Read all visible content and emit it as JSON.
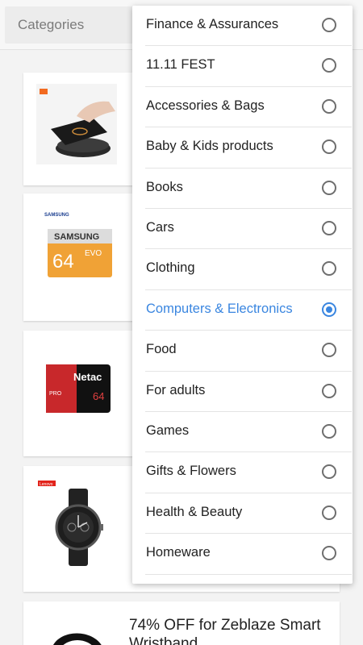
{
  "header": {
    "categories_label": "Categories"
  },
  "products": [
    {
      "title": ""
    },
    {
      "title": ""
    },
    {
      "title": ""
    },
    {
      "title": ""
    },
    {
      "title": "74% OFF for Zeblaze Smart Wristband"
    }
  ],
  "thumb_text": {
    "samsung_brand": "SAMSUNG",
    "samsung_card": "SAMSUNG",
    "samsung_cap": "64",
    "samsung_evo": "EVO",
    "netac_brand": "Netac",
    "netac_pro": "PRO",
    "netac_cap": "64",
    "lenovo_brand": "Lenovo"
  },
  "dropdown": {
    "options": [
      {
        "label": "Finance & Assurances",
        "selected": false
      },
      {
        "label": "11.11 FEST",
        "selected": false
      },
      {
        "label": "Accessories & Bags",
        "selected": false
      },
      {
        "label": "Baby & Kids products",
        "selected": false
      },
      {
        "label": "Books",
        "selected": false
      },
      {
        "label": "Cars",
        "selected": false
      },
      {
        "label": "Clothing",
        "selected": false
      },
      {
        "label": "Computers & Electronics",
        "selected": true
      },
      {
        "label": "Food",
        "selected": false
      },
      {
        "label": "For adults",
        "selected": false
      },
      {
        "label": "Games",
        "selected": false
      },
      {
        "label": "Gifts & Flowers",
        "selected": false
      },
      {
        "label": "Health & Beauty",
        "selected": false
      },
      {
        "label": "Homeware",
        "selected": false
      }
    ]
  },
  "colors": {
    "accent": "#3a86e0",
    "price_red": "#d33"
  }
}
